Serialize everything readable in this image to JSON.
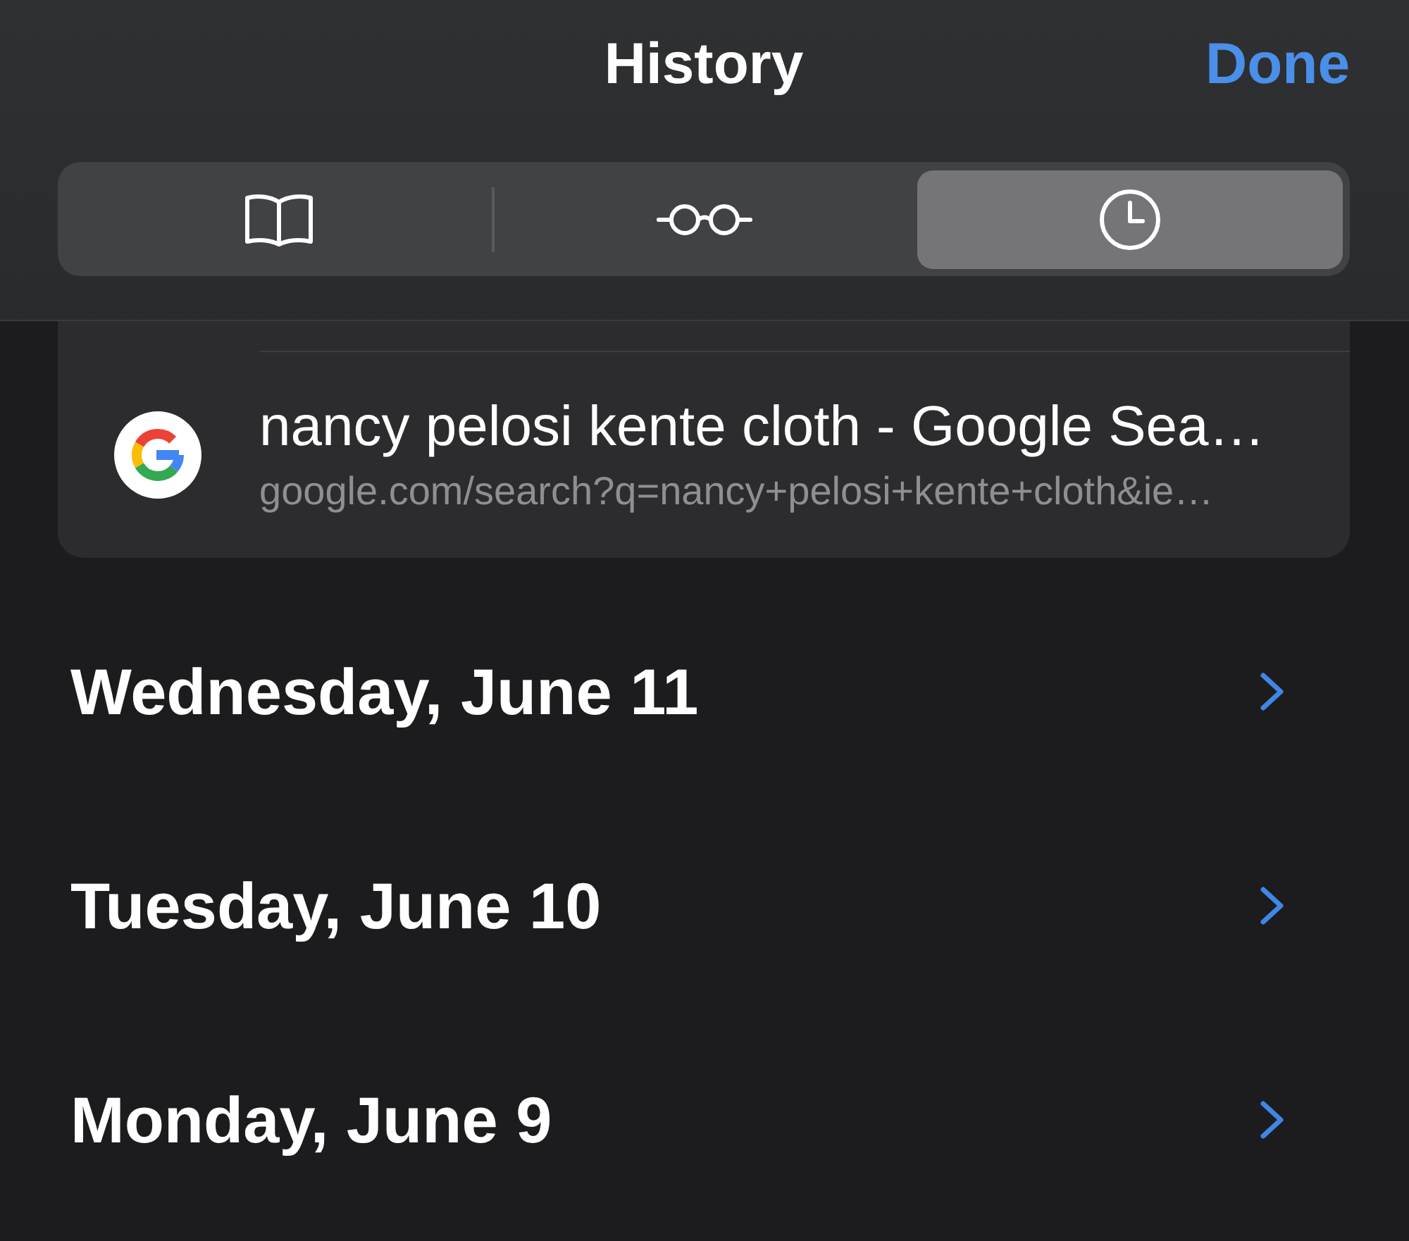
{
  "header": {
    "title": "History",
    "done_button": "Done"
  },
  "segments": [
    {
      "kind": "bookmarks",
      "selected": false
    },
    {
      "kind": "reading_list",
      "selected": false
    },
    {
      "kind": "history",
      "selected": true
    }
  ],
  "history_items": [
    {
      "title": "nancy pelosi kente cloth - Google Sea…",
      "url": "google.com/search?q=nancy+pelosi+kente+cloth&ie…"
    }
  ],
  "day_sections": [
    {
      "label": "Wednesday, June 11"
    },
    {
      "label": "Tuesday, June 10"
    },
    {
      "label": "Monday, June 9"
    }
  ]
}
